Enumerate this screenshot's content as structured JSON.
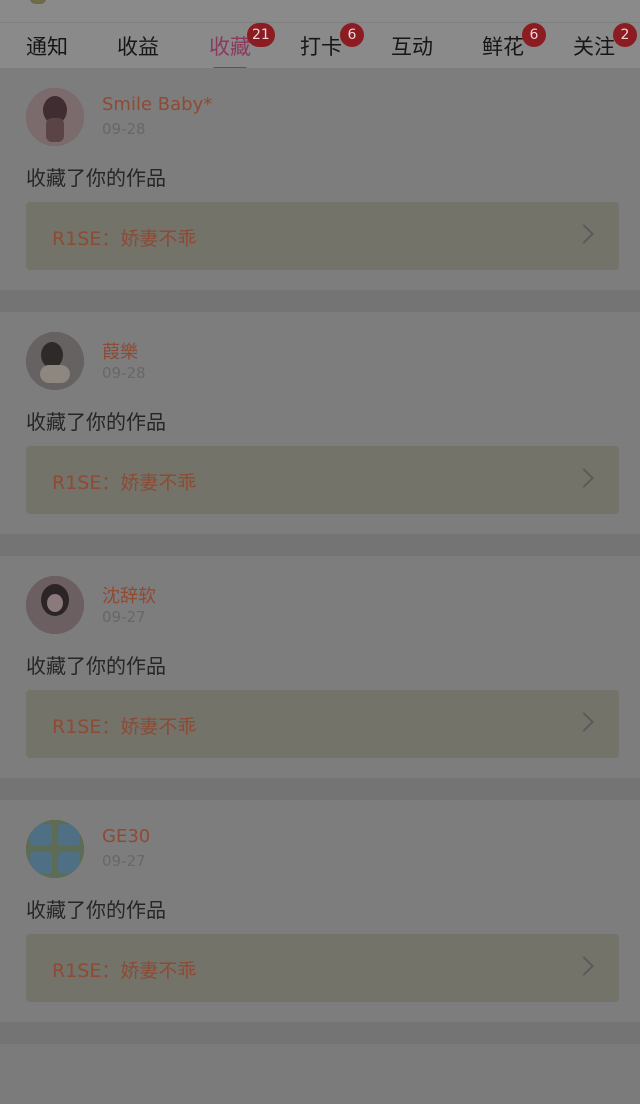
{
  "tabs": [
    {
      "label": "通知",
      "badge": ""
    },
    {
      "label": "收益",
      "badge": ""
    },
    {
      "label": "收藏",
      "badge": "21",
      "active": true
    },
    {
      "label": "打卡",
      "badge": "6"
    },
    {
      "label": "互动",
      "badge": ""
    },
    {
      "label": "鲜花",
      "badge": "6"
    },
    {
      "label": "关注",
      "badge": "2"
    }
  ],
  "feed": [
    {
      "user": "Smile Baby*",
      "date": "09-28",
      "action": "收藏了你的作品",
      "work": "R1SE：娇妻不乖"
    },
    {
      "user": "葭樂",
      "date": "09-28",
      "action": "收藏了你的作品",
      "work": "R1SE：娇妻不乖"
    },
    {
      "user": "沈辞软",
      "date": "09-27",
      "action": "收藏了你的作品",
      "work": "R1SE：娇妻不乖"
    },
    {
      "user": "GE30",
      "date": "09-27",
      "action": "收藏了你的作品",
      "work": "R1SE：娇妻不乖"
    }
  ],
  "colors": {
    "overlay_bg": "#7a7a7a",
    "active_tab": "#8b3a5d",
    "badge": "#8a1c22",
    "username": "#8e4a33"
  }
}
